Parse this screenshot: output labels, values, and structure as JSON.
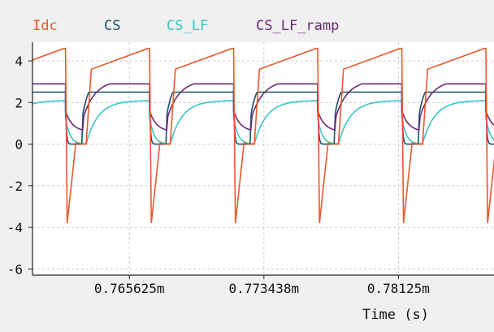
{
  "chart_data": {
    "type": "line",
    "xlabel": "Time (s)",
    "x_ticks": [
      {
        "value": 0.765625,
        "label": "0.765625m"
      },
      {
        "value": 0.773438,
        "label": "0.773438m"
      },
      {
        "value": 0.78125,
        "label": "0.78125m"
      }
    ],
    "xlim": [
      0.76,
      0.7868
    ],
    "y_ticks": [
      {
        "value": 4,
        "label": "4"
      },
      {
        "value": 2,
        "label": "2"
      },
      {
        "value": 0,
        "label": "0"
      },
      {
        "value": -2,
        "label": "-2"
      },
      {
        "value": -4,
        "label": "-4"
      },
      {
        "value": -6,
        "label": "-6"
      }
    ],
    "ylim": [
      -6.3,
      4.9
    ],
    "grid": true,
    "legend_position": "top",
    "period": 0.004883,
    "first_edge": 0.761914,
    "series": [
      {
        "name": "Idc",
        "color": "#e8582a",
        "waveform": {
          "pre_peak": 4.6,
          "dip": -3.8,
          "low": 0.0,
          "step": 3.6,
          "ramp_end": 4.6
        }
      },
      {
        "name": "CS",
        "color": "#1a4f6e",
        "waveform": {
          "high": 2.2,
          "low": 0.0,
          "rise_start": 1.7,
          "end": 2.2
        }
      },
      {
        "name": "CS_LF",
        "color": "#38c6c6",
        "waveform": {
          "high": 2.1,
          "low": 0.0,
          "end": 2.1
        }
      },
      {
        "name": "CS_LF_ramp",
        "color": "#6a2a72",
        "waveform": {
          "high": 2.6,
          "low": 0.6,
          "end": 2.6
        }
      }
    ]
  }
}
